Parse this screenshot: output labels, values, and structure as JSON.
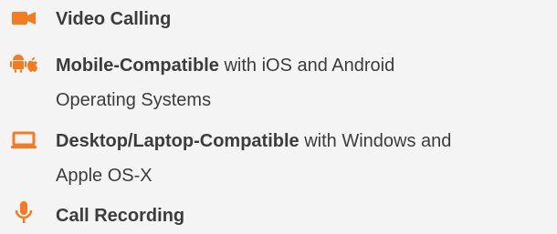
{
  "colors": {
    "accent": "#f47b20",
    "text": "#3c3c3c",
    "background": "#f4f4f4"
  },
  "features": [
    {
      "icon": "video-camera-icon",
      "title": "Video Calling",
      "description": ""
    },
    {
      "icon": "android-apple-icon",
      "title": "Mobile-Compatible",
      "description_line1": " with iOS and Android",
      "description_line2": "Operating Systems"
    },
    {
      "icon": "laptop-icon",
      "title": "Desktop/Laptop-Compatible",
      "description_line1": " with Windows and",
      "description_line2": "Apple OS-X"
    },
    {
      "icon": "microphone-icon",
      "title": "Call Recording",
      "description": ""
    }
  ]
}
